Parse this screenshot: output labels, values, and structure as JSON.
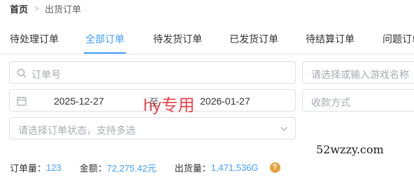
{
  "breadcrumb": {
    "home": "首页",
    "separator": ">",
    "current": "出货订单"
  },
  "tabs": [
    {
      "label": "待处理订单",
      "active": false
    },
    {
      "label": "全部订单",
      "active": true
    },
    {
      "label": "待发货订单",
      "active": false
    },
    {
      "label": "已发货订单",
      "active": false
    },
    {
      "label": "待结算订单",
      "active": false
    },
    {
      "label": "问题订单",
      "active": false
    }
  ],
  "filters": {
    "order_no_placeholder": "订单号",
    "game_placeholder": "请选择或输入游戏名称",
    "date_start": "2025-12-27",
    "date_separator": "至",
    "date_end": "2026-01-27",
    "payment_placeholder": "收款方式",
    "status_placeholder": "请选择订单状态，支持多选"
  },
  "overlays": {
    "watermark": "hy专用",
    "site": "52wzzy.com"
  },
  "stats": {
    "order_count_label": "订单量：",
    "order_count": "123",
    "amount_label": "金额：",
    "amount": "72,275.42元",
    "shipped_label": "出货量：",
    "shipped": "1,471,536G",
    "help_icon": "?"
  },
  "colors": {
    "accent": "#409eff",
    "warning": "#e6a23c",
    "watermark": "#e5272d"
  },
  "icons": {
    "search": "search-icon",
    "calendar": "calendar-icon",
    "dropdown": "chevron-down-icon",
    "help": "question-icon"
  }
}
